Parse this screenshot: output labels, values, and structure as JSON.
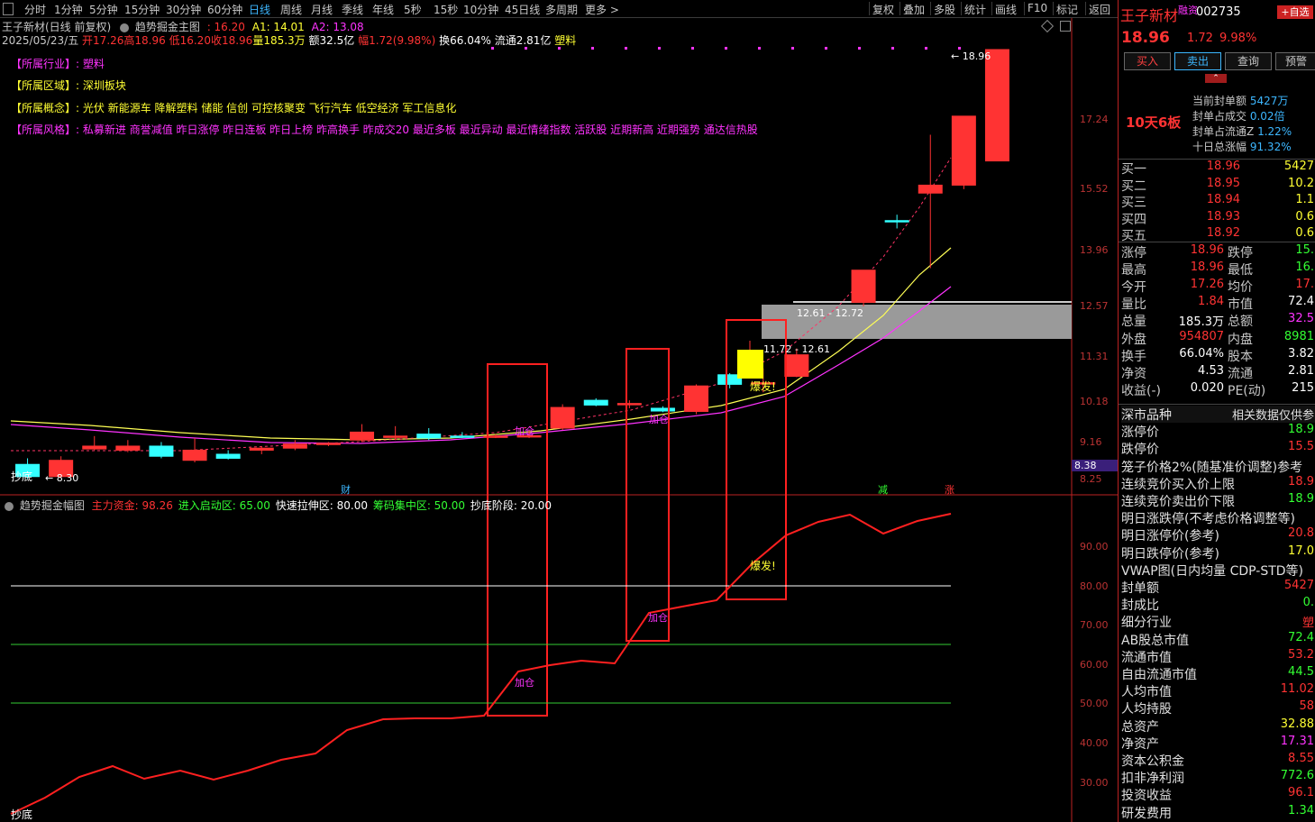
{
  "toolbar": {
    "timeframes": [
      "分时",
      "1分钟",
      "5分钟",
      "15分钟",
      "30分钟",
      "60分钟",
      "日线",
      "周线",
      "月线",
      "季线",
      "年线",
      "5秒",
      "15秒",
      "10分钟",
      "45日线",
      "多周期",
      "更多 >"
    ],
    "right_buttons": [
      "复权",
      "叠加",
      "多股",
      "统计",
      "画线",
      "F10",
      "标记",
      "返回"
    ]
  },
  "chart_header": {
    "line1": {
      "title": "王子新材(日线 前复权)",
      "indicator": "趋势掘金主图",
      "v1": ": 16.20",
      "a1": "A1: 14.01",
      "a2": "A2: 13.08"
    },
    "line2": {
      "date": "2025/05/23/五",
      "open": "开17.26",
      "high": "高18.96",
      "low": "低16.20",
      "close": "收18.96",
      "vol": "量185.3万",
      "amount": "额32.5亿",
      "change": "幅1.72(9.98%)",
      "turnover": "换66.04%",
      "float_cap": "流通2.81亿",
      "sector": "塑料"
    }
  },
  "info_lines": {
    "industry_label": "【所属行业】:",
    "industry_value": "塑料",
    "region_label": "【所属区域】:",
    "region_value": "深圳板块",
    "concept_label": "【所属概念】:",
    "concept_value": "光伏 新能源车 降解塑料 储能 信创 可控核聚变 飞行汽车 低空经济 军工信息化",
    "style_label": "【所属风格】:",
    "style_value": "私募新进 商誉减值 昨日涨停 昨日连板 昨日上榜 昨高换手 昨成交20 最近多板 最近异动 最近情绪指数 活跃股 近期新高 近期强势 通达信热股"
  },
  "main_chart": {
    "y_ticks": [
      "17.24",
      "15.52",
      "13.96",
      "12.57",
      "11.31",
      "10.18",
      "9.16",
      "8.25"
    ],
    "price_current_label": "8.38",
    "top_marker": "18.96",
    "low_marker": "8.30",
    "zone_label_1": "12.61 - 12.72",
    "zone_label_2": "11.72 - 12.61",
    "signal_labels": [
      "加仓",
      "加仓",
      "爆发!"
    ],
    "bottom_tag": "抄底",
    "event_tags": [
      "财",
      "减",
      "涨"
    ]
  },
  "sub_chart": {
    "title": "趋势掘金幅图",
    "main_fund": "主力资金: 98.26",
    "start_zone": "进入启动区: 65.00",
    "rally_zone": "快速拉伸区: 80.00",
    "chip_zone": "筹码集中区: 50.00",
    "bottom_stage": "抄底阶段: 20.00",
    "y_ticks": [
      "90.00",
      "80.00",
      "70.00",
      "60.00",
      "50.00",
      "40.00",
      "30.00"
    ],
    "signal_labels": [
      "加仓",
      "加仓",
      "爆发!"
    ],
    "bottom_tag": "抄底"
  },
  "chart_data": {
    "type": "candlestick",
    "candles": [
      {
        "o": 8.6,
        "c": 8.3,
        "h": 8.75,
        "l": 8.25
      },
      {
        "o": 8.3,
        "c": 8.7,
        "h": 8.8,
        "l": 8.28
      },
      {
        "o": 8.98,
        "c": 9.05,
        "h": 9.3,
        "l": 8.95
      },
      {
        "o": 8.95,
        "c": 9.05,
        "h": 9.2,
        "l": 8.9
      },
      {
        "o": 9.05,
        "c": 8.8,
        "h": 9.15,
        "l": 8.75
      },
      {
        "o": 8.7,
        "c": 8.95,
        "h": 9.25,
        "l": 8.65
      },
      {
        "o": 8.85,
        "c": 8.75,
        "h": 8.95,
        "l": 8.72
      },
      {
        "o": 8.95,
        "c": 9.0,
        "h": 9.05,
        "l": 8.85
      },
      {
        "o": 9.0,
        "c": 9.1,
        "h": 9.2,
        "l": 8.95
      },
      {
        "o": 9.1,
        "c": 9.12,
        "h": 9.15,
        "l": 9.05
      },
      {
        "o": 9.2,
        "c": 9.4,
        "h": 9.6,
        "l": 9.15
      },
      {
        "o": 9.3,
        "c": 9.3,
        "h": 9.55,
        "l": 9.2
      },
      {
        "o": 9.35,
        "c": 9.25,
        "h": 9.5,
        "l": 9.2
      },
      {
        "o": 9.3,
        "c": 9.27,
        "h": 9.4,
        "l": 9.25
      },
      {
        "o": 9.28,
        "c": 9.3,
        "h": 9.35,
        "l": 9.25
      },
      {
        "o": 9.3,
        "c": 9.31,
        "h": 9.45,
        "l": 9.25
      },
      {
        "o": 9.5,
        "c": 10.02,
        "h": 10.1,
        "l": 9.45
      },
      {
        "o": 10.2,
        "c": 10.08,
        "h": 10.25,
        "l": 10.05
      },
      {
        "o": 10.1,
        "c": 10.12,
        "h": 10.2,
        "l": 10.0
      },
      {
        "o": 10.0,
        "c": 9.93,
        "h": 10.05,
        "l": 9.9
      },
      {
        "o": 9.92,
        "c": 10.56,
        "h": 10.6,
        "l": 9.85
      },
      {
        "o": 10.84,
        "c": 10.6,
        "h": 10.88,
        "l": 10.5
      },
      {
        "o": 10.62,
        "c": 10.64,
        "h": 11.0,
        "l": 10.4
      },
      {
        "o": 10.8,
        "c": 11.34,
        "h": 11.5,
        "l": 10.78
      },
      {
        "o": 0,
        "c": 0,
        "h": 0,
        "l": 0
      },
      {
        "o": 12.65,
        "c": 13.45,
        "h": 13.45,
        "l": 12.55
      },
      {
        "o": 14.7,
        "c": 14.68,
        "h": 14.85,
        "l": 14.5
      },
      {
        "o": 15.4,
        "c": 15.6,
        "h": 16.85,
        "l": 13.5
      },
      {
        "o": 15.6,
        "c": 17.31,
        "h": 17.31,
        "l": 15.5
      },
      {
        "o": 16.2,
        "c": 18.96,
        "h": 18.96,
        "l": 16.2
      }
    ],
    "sub_series": [
      20,
      28,
      32,
      34,
      31,
      33,
      31,
      33,
      36,
      38,
      43,
      46,
      46,
      46,
      46,
      47,
      55,
      60,
      61,
      60,
      73,
      74,
      76,
      79,
      86,
      93,
      96,
      98,
      93,
      96,
      98
    ],
    "ylim_main": [
      8.25,
      18.96
    ],
    "ylim_sub": [
      20,
      100
    ]
  }
}
